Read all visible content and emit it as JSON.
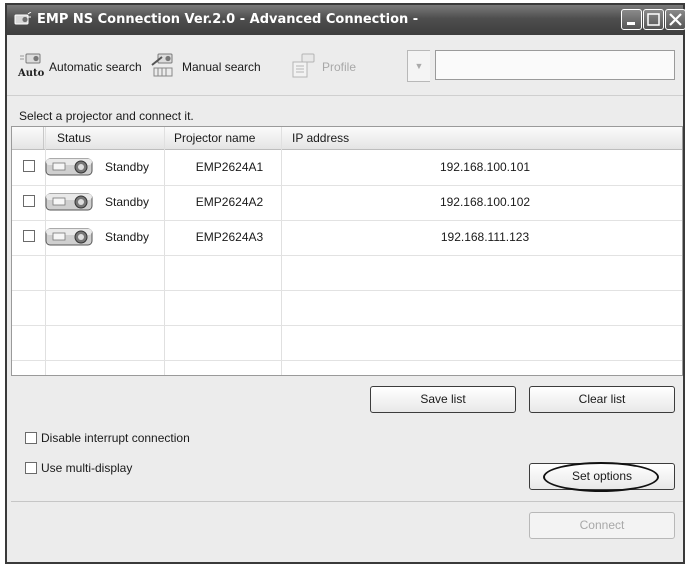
{
  "window": {
    "title": "EMP NS Connection Ver.2.0 - Advanced Connection -",
    "controls": [
      "minimize",
      "maximize",
      "close"
    ]
  },
  "toolbar": {
    "automatic_search": {
      "label": "Automatic search",
      "icon_caption": "Auto",
      "icon": "automatic-search-icon"
    },
    "manual_search": {
      "label": "Manual search",
      "icon": "manual-search-icon"
    },
    "profile": {
      "label": "Profile",
      "icon": "profile-icon",
      "enabled": false
    },
    "profile_value": ""
  },
  "instruction": "Select a projector and connect it.",
  "projector_list": {
    "columns": [
      "Status",
      "Projector name",
      "IP address"
    ],
    "rows": [
      {
        "checked": false,
        "status": "Standby",
        "name": "EMP2624A1",
        "ip": "192.168.100.101"
      },
      {
        "checked": false,
        "status": "Standby",
        "name": "EMP2624A2",
        "ip": "192.168.100.102"
      },
      {
        "checked": false,
        "status": "Standby",
        "name": "EMP2624A3",
        "ip": "192.168.111.123"
      }
    ]
  },
  "buttons": {
    "save_list": "Save list",
    "clear_list": "Clear list",
    "set_options": "Set options",
    "connect": "Connect"
  },
  "options": {
    "disable_interrupt": {
      "label": "Disable interrupt connection",
      "checked": false
    },
    "multi_display": {
      "label": "Use multi-display",
      "checked": false
    }
  }
}
